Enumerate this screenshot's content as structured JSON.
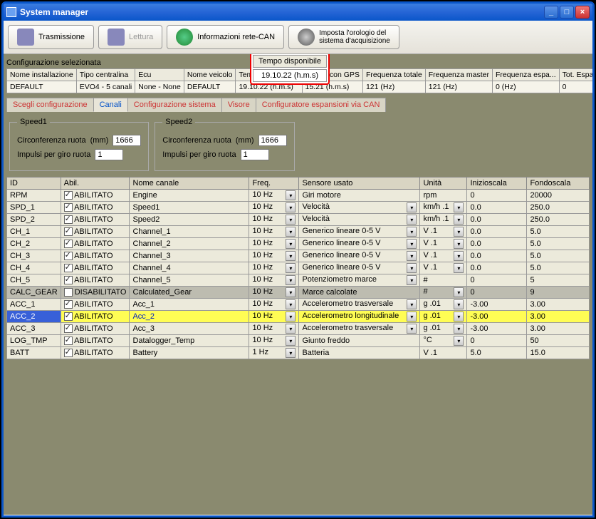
{
  "window": {
    "title": "System manager"
  },
  "toolbar": {
    "transmit": "Trasmissione",
    "read": "Lettura",
    "can_info": "Informazioni rete-CAN",
    "set_clock": "Imposta l'orologio del\nsistema d'acquisizione"
  },
  "config_label": "Configurazione selezionata",
  "info_headers": [
    "Nome installazione",
    "Tipo centralina",
    "Ecu",
    "Nome veicolo",
    "Tempo disponibile",
    "Tempo con GPS",
    "Frequenza totale",
    "Frequenza master",
    "Frequenza espa...",
    "Tot. Espansioni"
  ],
  "info_row": [
    "DEFAULT",
    "EVO4 - 5 canali",
    "None - None",
    "DEFAULT",
    "19.10.22 (h.m.s)",
    "15.21 (h.m.s)",
    "121 (Hz)",
    "121 (Hz)",
    "0 (Hz)",
    "0"
  ],
  "tabs": [
    "Scegli configurazione",
    "Canali",
    "Configurazione sistema",
    "Visore",
    "Configuratore espansioni via CAN"
  ],
  "active_tab": 1,
  "speed": {
    "g1": {
      "legend": "Speed1",
      "circ_label": "Circonferenza ruota",
      "circ_unit": "(mm)",
      "circ_val": "1666",
      "imp_label": "Impulsi per giro ruota",
      "imp_val": "1"
    },
    "g2": {
      "legend": "Speed2",
      "circ_label": "Circonferenza ruota",
      "circ_unit": "(mm)",
      "circ_val": "1666",
      "imp_label": "Impulsi per giro ruota",
      "imp_val": "1"
    }
  },
  "grid": {
    "headers": [
      "ID",
      "Abil.",
      "Nome canale",
      "Freq.",
      "Sensore usato",
      "Unità",
      "Inizioscala",
      "Fondoscala"
    ],
    "rows": [
      {
        "id": "RPM",
        "en": true,
        "name": "Engine",
        "freq": "10 Hz",
        "sens": "Giri motore",
        "unit": "rpm",
        "lo": "0",
        "hi": "20000",
        "sens_dd": false,
        "unit_dd": false
      },
      {
        "id": "SPD_1",
        "en": true,
        "name": "Speed1",
        "freq": "10 Hz",
        "sens": "Velocità",
        "unit": "km/h .1",
        "lo": "0.0",
        "hi": "250.0",
        "sens_dd": true,
        "unit_dd": true
      },
      {
        "id": "SPD_2",
        "en": true,
        "name": "Speed2",
        "freq": "10 Hz",
        "sens": "Velocità",
        "unit": "km/h .1",
        "lo": "0.0",
        "hi": "250.0",
        "sens_dd": true,
        "unit_dd": true
      },
      {
        "id": "CH_1",
        "en": true,
        "name": "Channel_1",
        "freq": "10 Hz",
        "sens": "Generico lineare 0-5 V",
        "unit": "V .1",
        "lo": "0.0",
        "hi": "5.0",
        "sens_dd": true,
        "unit_dd": true
      },
      {
        "id": "CH_2",
        "en": true,
        "name": "Channel_2",
        "freq": "10 Hz",
        "sens": "Generico lineare 0-5 V",
        "unit": "V .1",
        "lo": "0.0",
        "hi": "5.0",
        "sens_dd": true,
        "unit_dd": true
      },
      {
        "id": "CH_3",
        "en": true,
        "name": "Channel_3",
        "freq": "10 Hz",
        "sens": "Generico lineare 0-5 V",
        "unit": "V .1",
        "lo": "0.0",
        "hi": "5.0",
        "sens_dd": true,
        "unit_dd": true
      },
      {
        "id": "CH_4",
        "en": true,
        "name": "Channel_4",
        "freq": "10 Hz",
        "sens": "Generico lineare 0-5 V",
        "unit": "V .1",
        "lo": "0.0",
        "hi": "5.0",
        "sens_dd": true,
        "unit_dd": true
      },
      {
        "id": "CH_5",
        "en": true,
        "name": "Channel_5",
        "freq": "10 Hz",
        "sens": "Potenziometro marce",
        "unit": "#",
        "lo": "0",
        "hi": "5",
        "sens_dd": true,
        "unit_dd": false
      },
      {
        "id": "CALC_GEAR",
        "en": false,
        "name": "Calculated_Gear",
        "freq": "10 Hz",
        "sens": "Marce calcolate",
        "unit": "#",
        "lo": "0",
        "hi": "9",
        "sens_dd": false,
        "unit_dd": true,
        "disabled": true,
        "abil_label": "DISABILITATO"
      },
      {
        "id": "ACC_1",
        "en": true,
        "name": "Acc_1",
        "freq": "10 Hz",
        "sens": "Accelerometro trasversale",
        "unit": "g .01",
        "lo": "-3.00",
        "hi": "3.00",
        "sens_dd": true,
        "unit_dd": true
      },
      {
        "id": "ACC_2",
        "en": true,
        "name": "Acc_2",
        "freq": "10 Hz",
        "sens": "Accelerometro longitudinale",
        "unit": "g .01",
        "lo": "-3.00",
        "hi": "3.00",
        "sens_dd": true,
        "unit_dd": true,
        "hl": true,
        "sel": true
      },
      {
        "id": "ACC_3",
        "en": true,
        "name": "Acc_3",
        "freq": "10 Hz",
        "sens": "Accelerometro trasversale",
        "unit": "g .01",
        "lo": "-3.00",
        "hi": "3.00",
        "sens_dd": true,
        "unit_dd": true
      },
      {
        "id": "LOG_TMP",
        "en": true,
        "name": "Datalogger_Temp",
        "freq": "10 Hz",
        "sens": "Giunto freddo",
        "unit": "°C",
        "lo": "0",
        "hi": "50",
        "sens_dd": false,
        "unit_dd": true
      },
      {
        "id": "BATT",
        "en": true,
        "name": "Battery",
        "freq": "1 Hz",
        "sens": "Batteria",
        "unit": "V .1",
        "lo": "5.0",
        "hi": "15.0",
        "sens_dd": false,
        "unit_dd": false
      }
    ],
    "abil_true": "ABILITATO"
  },
  "highlight": {
    "label": "Tempo disponibile",
    "value": "19.10.22 (h.m.s)"
  }
}
